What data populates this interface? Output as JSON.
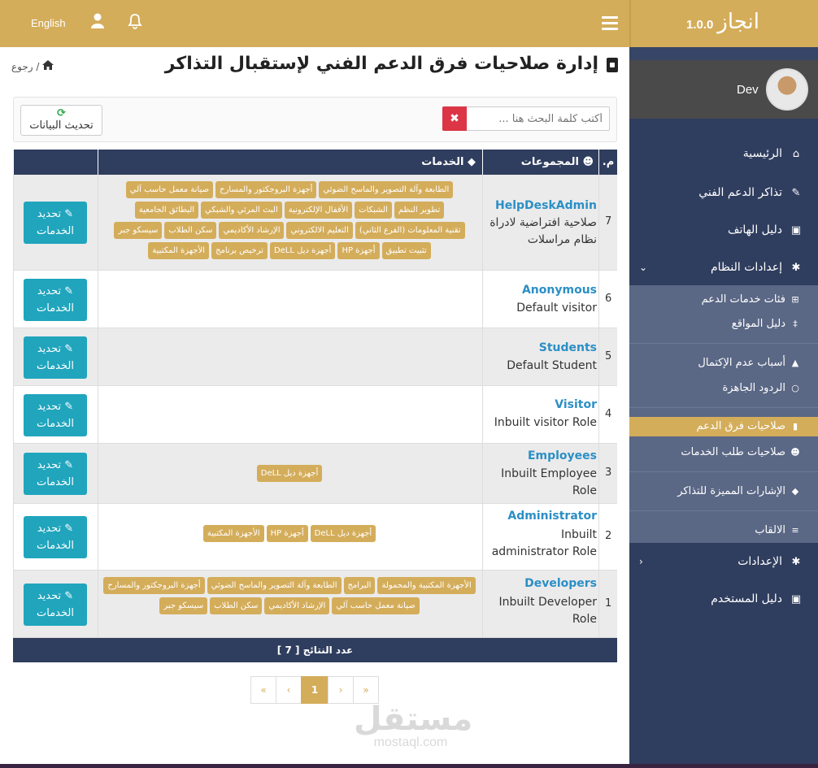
{
  "topbar": {
    "language": "English"
  },
  "sidebar": {
    "brand": "انجاز",
    "version": "1.0.0",
    "user": "Dev",
    "items": [
      {
        "label": "الرئيسية"
      },
      {
        "label": "تذاكر الدعم الفني"
      },
      {
        "label": "دليل الهاتف"
      },
      {
        "label": "إعدادات النظام"
      },
      {
        "label": "الإعدادات"
      },
      {
        "label": "دليل المستخدم"
      }
    ],
    "submenu": [
      {
        "label": "فئات خدمات الدعم"
      },
      {
        "label": "دليل المواقع"
      },
      {
        "label": "أسباب عدم الإكتمال"
      },
      {
        "label": "الردود الجاهزة"
      },
      {
        "label": "صلاحيات فرق الدعم"
      },
      {
        "label": "صلاحيات طلب الخدمات"
      },
      {
        "label": "الإشارات المميزة للتذاكر"
      },
      {
        "label": "الالقاب"
      }
    ]
  },
  "page": {
    "title": "إدارة صلاحيات فرق الدعم الفني لإستقبال التذاكر",
    "back": "رجوع",
    "search_placeholder": "أكتب كلمة البحث هنا ...",
    "clear": "✖",
    "refresh_label": "تحديث البيانات"
  },
  "table": {
    "headers": {
      "num": "م.",
      "groups": "المجموعات",
      "services": "الخدمات"
    },
    "update_label_1": "تحديد",
    "update_label_2": "الخدمات",
    "rows": [
      {
        "num": "7",
        "name": "HelpDeskAdmin",
        "desc": "صلاحية افتراضية لادراة نظام مراسلات",
        "tags": [
          "الطابعة وآلة التصوير والماسح الضوئي",
          "أجهزة البروجكتور والمسارح",
          "صيانة معمل حاسب آلي",
          "تطوير النظم",
          "الشبكات",
          "الأقفال الإلكترونية",
          "البث المرئي والشبكي",
          "البطائق الجامعية",
          "تقنية المعلومات (الفرع الثاني)",
          "التعليم الالكتروني",
          "الإرشاد الأكاديمي",
          "سكن الطلاب",
          "سيسكو جبر",
          "تثبيت تطبيق",
          "أجهزة HP",
          "أجهزة ديل DeLL",
          "ترخيص برنامج",
          "الأجهزة المكتبية"
        ]
      },
      {
        "num": "6",
        "name": "Anonymous",
        "desc": "Default visitor",
        "tags": []
      },
      {
        "num": "5",
        "name": "Students",
        "desc": "Default Student",
        "tags": []
      },
      {
        "num": "4",
        "name": "Visitor",
        "desc": "Inbuilt visitor Role",
        "tags": []
      },
      {
        "num": "3",
        "name": "Employees",
        "desc": "Inbuilt Employee Role",
        "tags": [
          "أجهزة ديل DeLL"
        ]
      },
      {
        "num": "2",
        "name": "Administrator",
        "desc": "Inbuilt administrator Role",
        "tags": [
          "أجهزة ديل DeLL",
          "أجهزة HP",
          "الأجهزة المكتبية"
        ]
      },
      {
        "num": "1",
        "name": "Developers",
        "desc": "Inbuilt Developer Role",
        "tags": [
          "الأجهزة المكتبية والمحمولة",
          "البرامج",
          "الطابعة وآلة التصوير والماسح الضوئي",
          "أجهزة البروجكتور والمسارح",
          "صيانة معمل حاسب آلي",
          "الإرشاد الأكاديمي",
          "سكن الطلاب",
          "سيسكو جبر"
        ]
      }
    ],
    "footer": "عدد النتائج [ 7 ]"
  },
  "pagination": {
    "pages": [
      "«",
      "‹",
      "1",
      "›",
      "»"
    ],
    "current": "1"
  },
  "watermark": {
    "line1": "مستقل",
    "line2": "mostaql.com"
  },
  "colors": {
    "accent": "#d4ad5b",
    "navy": "#2f3d5e",
    "teal": "#20a5bd",
    "link": "#2b8fc6"
  }
}
